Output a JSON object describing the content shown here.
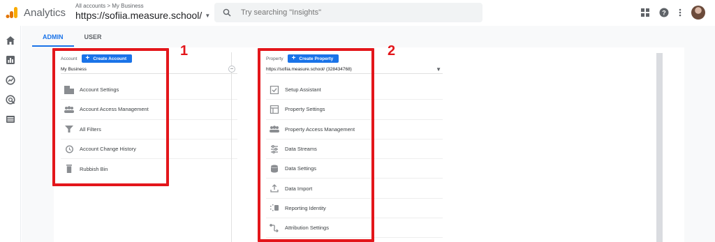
{
  "header": {
    "app_name": "Analytics",
    "breadcrumb": "All accounts > My Business",
    "property_name": "https://sofiia.measure.school/",
    "search_placeholder": "Try searching \"Insights\""
  },
  "tabs": [
    {
      "label": "ADMIN",
      "active": true
    },
    {
      "label": "USER",
      "active": false
    }
  ],
  "account_column": {
    "heading": "Account",
    "create_button": "Create Account",
    "selected": "My Business",
    "items": [
      {
        "label": "Account Settings",
        "icon": "building-icon"
      },
      {
        "label": "Account Access Management",
        "icon": "people-icon"
      },
      {
        "label": "All Filters",
        "icon": "filter-icon"
      },
      {
        "label": "Account Change History",
        "icon": "history-icon"
      },
      {
        "label": "Rubbish Bin",
        "icon": "trash-icon"
      }
    ]
  },
  "property_column": {
    "heading": "Property",
    "create_button": "Create Property",
    "selected": "https://sofiia.measure.school/ (328434768)",
    "items": [
      {
        "label": "Setup Assistant",
        "icon": "checkbox-icon"
      },
      {
        "label": "Property Settings",
        "icon": "layout-icon"
      },
      {
        "label": "Property Access Management",
        "icon": "people-icon"
      },
      {
        "label": "Data Streams",
        "icon": "streams-icon"
      },
      {
        "label": "Data Settings",
        "icon": "database-icon"
      },
      {
        "label": "Data Import",
        "icon": "upload-icon"
      },
      {
        "label": "Reporting Identity",
        "icon": "identity-icon"
      },
      {
        "label": "Attribution Settings",
        "icon": "attribution-icon"
      }
    ]
  },
  "annotations": {
    "one": "1",
    "two": "2"
  },
  "colors": {
    "accent": "#1a73e8",
    "highlight": "#e3161b",
    "logo_orange": "#f9ab00",
    "logo_dark": "#e37400"
  }
}
